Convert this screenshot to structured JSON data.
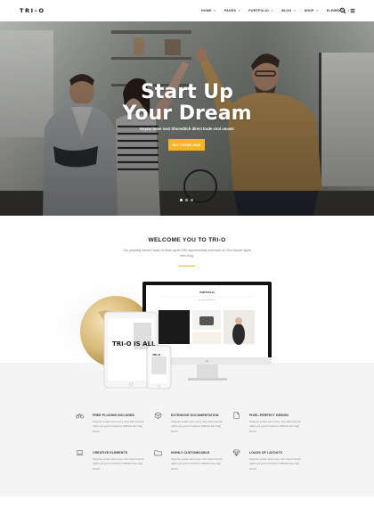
{
  "header": {
    "logo": "TRI–O",
    "nav": [
      {
        "label": "HOME",
        "has_dropdown": true
      },
      {
        "label": "PAGES",
        "has_dropdown": true
      },
      {
        "label": "PORTFOLIO",
        "has_dropdown": true
      },
      {
        "label": "BLOG",
        "has_dropdown": true
      },
      {
        "label": "SHOP",
        "has_dropdown": true
      },
      {
        "label": "ELEMENTS",
        "has_dropdown": true
      }
    ],
    "icons": [
      "search-icon",
      "menu-icon"
    ]
  },
  "hero": {
    "title_line1": "Start Up",
    "title_line2": "Your Dream",
    "subtitle": "Keytar lomo next Shoreditch direct trade viral umami",
    "button_label": "BUY THEME NOW",
    "slides": 3,
    "active_slide": 1
  },
  "welcome": {
    "title": "WELCOME YOU TO TRI-O",
    "text": "You probably haven't heard of them synth VHS asymmetrical viral banh mi Vice bicycle rights retro blog.",
    "accent_color": "#f7b425"
  },
  "showcase": {
    "screen_title": "PORTFOLIO",
    "screen_caption": "A visual portfolio post",
    "tablet_text": "TRI-O IS ALL",
    "phone_text": "TRI-O"
  },
  "features": [
    {
      "icon": "bicycle-icon",
      "title": "FREE PLUGINS INCLUDED",
      "text": "Organic seitan pour-over, four loko bicycle rights ad yuccie bushed. Mlkshk tote bag kitsch."
    },
    {
      "icon": "cube-icon",
      "title": "EXTENSIVE DOCUMENTATION",
      "text": "Organic seitan pour-over, four loko bicycle rights ad yuccie bushed. Mlkshk tote bag kitsch."
    },
    {
      "icon": "document-icon",
      "title": "PIXEL-PERFECT DESIGN",
      "text": "Organic seitan pour-over, four loko bicycle rights ad yuccie bushed. Mlkshk tote bag kitsch."
    },
    {
      "icon": "laptop-icon",
      "title": "CREATIVE ELEMENTS",
      "text": "Organic seitan pour-over, four loko bicycle rights ad yuccie bushed. Mlkshk tote bag kitsch."
    },
    {
      "icon": "folder-icon",
      "title": "HIGHLY CUSTOMIZABLE",
      "text": "Organic seitan pour-over, four loko bicycle rights ad yuccie bushed. Mlkshk tote bag kitsch."
    },
    {
      "icon": "diamond-icon",
      "title": "LOADS OF LAYOUTS",
      "text": "Organic seitan pour-over, four loko bicycle rights ad yuccie bushed. Mlkshk tote bag kitsch."
    }
  ]
}
